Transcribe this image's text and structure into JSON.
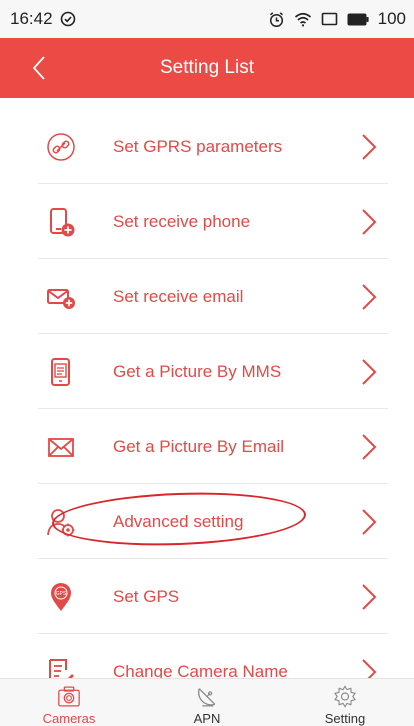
{
  "status_bar": {
    "time": "16:42",
    "battery": "100",
    "icons": [
      "check-circle-icon",
      "alarm-icon",
      "wifi-icon",
      "screen-icon",
      "battery-icon"
    ]
  },
  "header": {
    "title": "Setting List",
    "back_icon": "back-chevron-icon",
    "color": "#ec4a44"
  },
  "list": {
    "accent_color": "#e24a47",
    "items": [
      {
        "label": "Set GPRS parameters",
        "icon": "link-icon"
      },
      {
        "label": "Set receive phone",
        "icon": "phone-add-icon"
      },
      {
        "label": "Set receive email",
        "icon": "email-add-icon"
      },
      {
        "label": "Get a Picture By MMS",
        "icon": "mms-phone-icon"
      },
      {
        "label": "Get a Picture By Email",
        "icon": "envelope-icon"
      },
      {
        "label": "Advanced setting",
        "icon": "user-gear-icon",
        "highlighted": true
      },
      {
        "label": "Set GPS",
        "icon": "gps-pin-icon"
      },
      {
        "label": "Change Camera Name",
        "icon": "edit-note-icon"
      }
    ]
  },
  "tabbar": {
    "tabs": [
      {
        "label": "Cameras",
        "icon": "camera-icon",
        "active": true
      },
      {
        "label": "APN",
        "icon": "satellite-dish-icon",
        "active": false
      },
      {
        "label": "Setting",
        "icon": "gear-icon",
        "active": false
      }
    ]
  }
}
